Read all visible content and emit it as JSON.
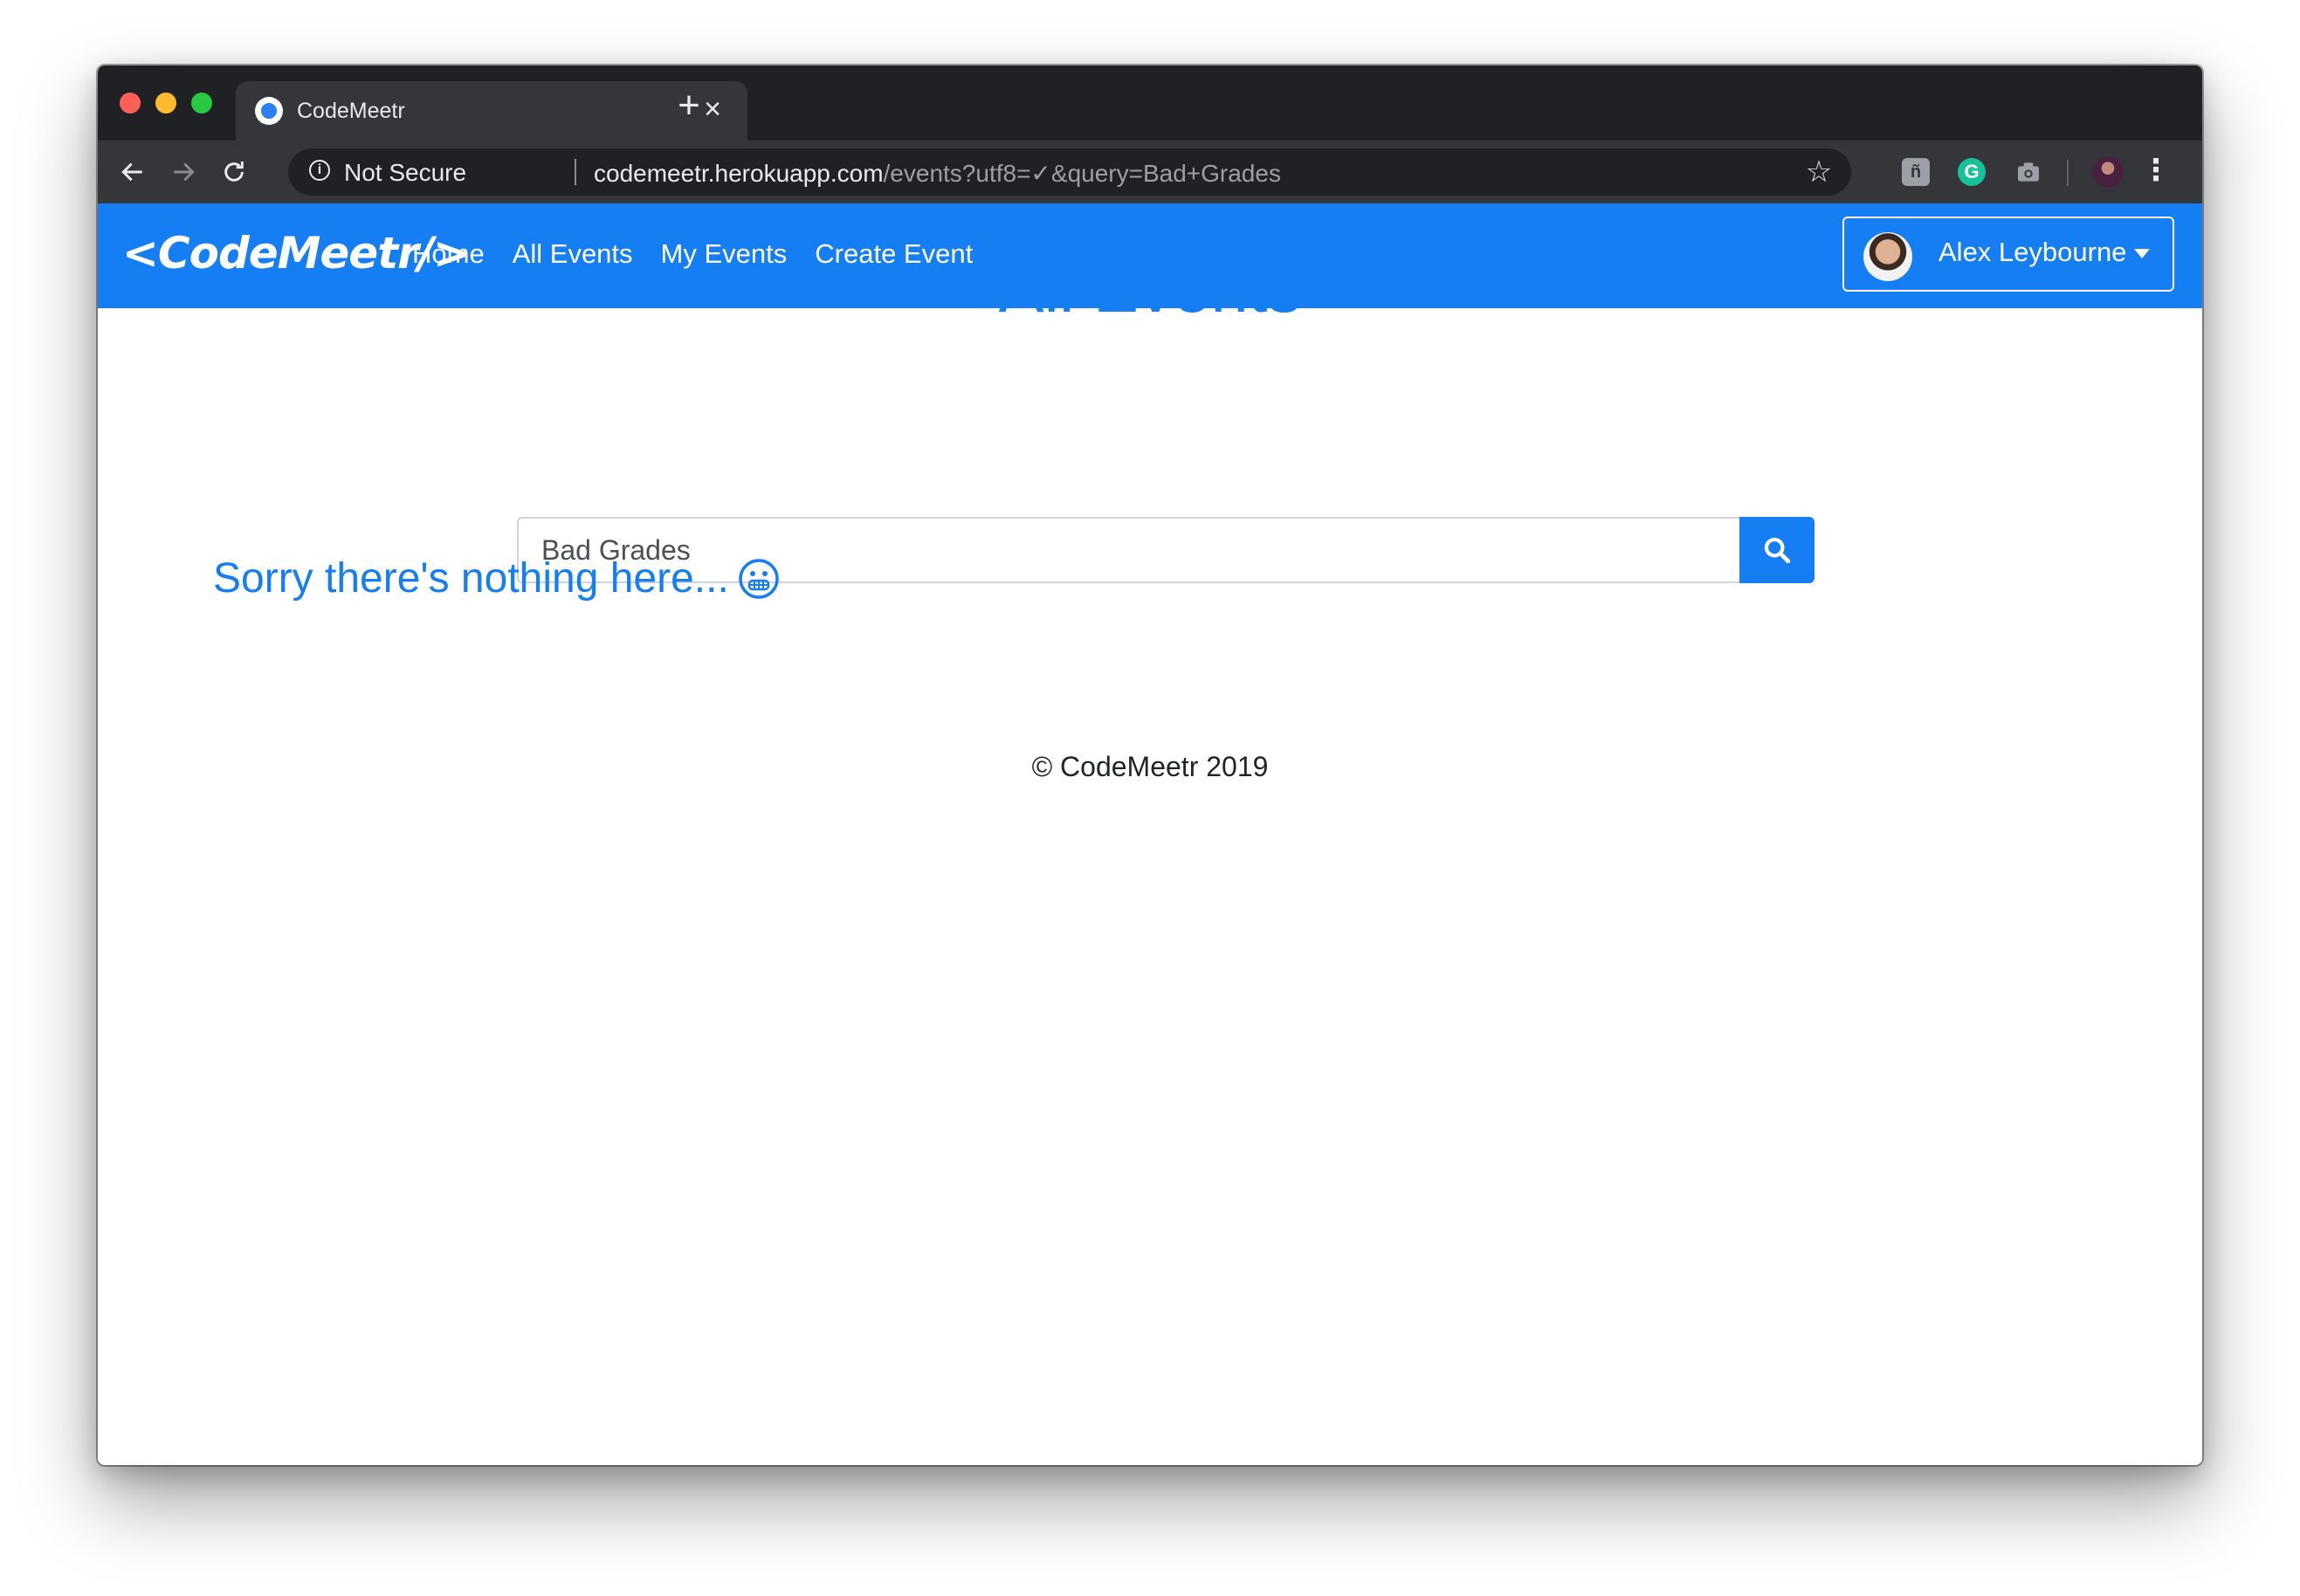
{
  "browser": {
    "tab_title": "CodeMeetr",
    "security_label": "Not Secure",
    "url_host": "codemeetr.herokuapp.com",
    "url_path": "/events?utf8=✓&query=Bad+Grades"
  },
  "navbar": {
    "brand": "<CodeMeetr/>",
    "links": [
      "Home",
      "All Events",
      "My Events",
      "Create Event"
    ],
    "user_name": "Alex Leybourne"
  },
  "main": {
    "title": "All Events",
    "search_value": "Bad Grades",
    "empty_message": "Sorry there's nothing here...",
    "empty_icon": "grimace-face-icon"
  },
  "footer": {
    "text": "© CodeMeetr 2019"
  },
  "colors": {
    "primary": "#157ef3",
    "chrome_dark": "#202124",
    "chrome_toolbar": "#35363a"
  }
}
